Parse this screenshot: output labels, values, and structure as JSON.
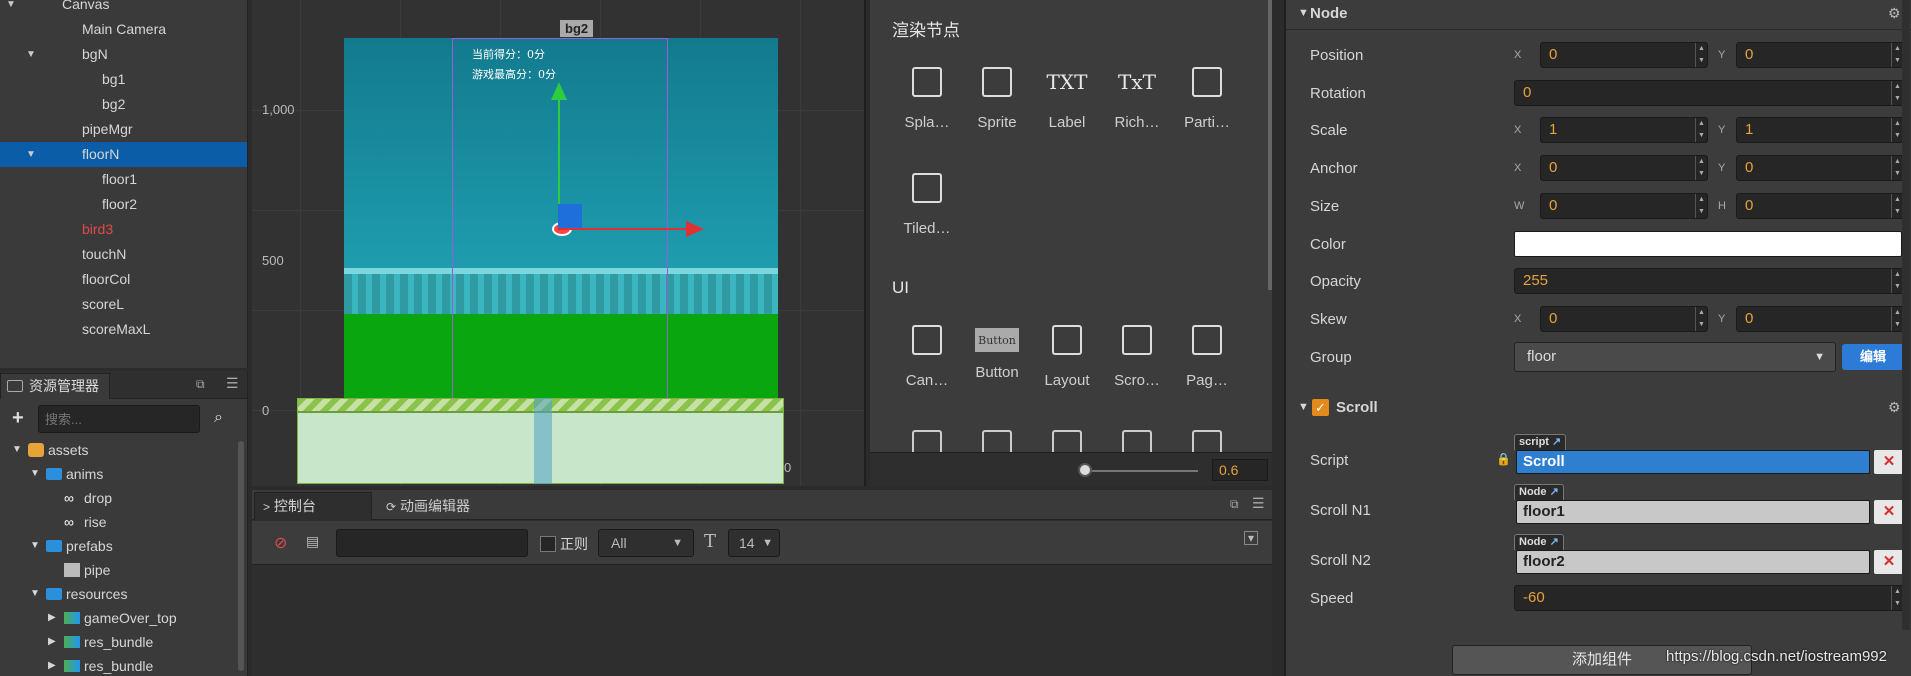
{
  "hierarchy": {
    "items": [
      {
        "label": "Canvas",
        "depth": 0,
        "arrow": "open"
      },
      {
        "label": "Main Camera",
        "depth": 1,
        "arrow": ""
      },
      {
        "label": "bgN",
        "depth": 1,
        "arrow": "open"
      },
      {
        "label": "bg1",
        "depth": 2,
        "arrow": ""
      },
      {
        "label": "bg2",
        "depth": 2,
        "arrow": ""
      },
      {
        "label": "pipeMgr",
        "depth": 1,
        "arrow": ""
      },
      {
        "label": "floorN",
        "depth": 1,
        "arrow": "open",
        "selected": true
      },
      {
        "label": "floor1",
        "depth": 2,
        "arrow": ""
      },
      {
        "label": "floor2",
        "depth": 2,
        "arrow": ""
      },
      {
        "label": "bird3",
        "depth": 1,
        "arrow": "",
        "color": "#e04a4a"
      },
      {
        "label": "touchN",
        "depth": 1,
        "arrow": ""
      },
      {
        "label": "floorCol",
        "depth": 1,
        "arrow": ""
      },
      {
        "label": "scoreL",
        "depth": 1,
        "arrow": ""
      },
      {
        "label": "scoreMaxL",
        "depth": 1,
        "arrow": ""
      }
    ]
  },
  "assets": {
    "tab_label": "资源管理器",
    "search_placeholder": "搜索...",
    "tree": [
      {
        "label": "assets",
        "depth": 0,
        "arrow": "▼",
        "icon": "db-icon"
      },
      {
        "label": "anims",
        "depth": 1,
        "arrow": "▼",
        "icon": "folder-icon"
      },
      {
        "label": "drop",
        "depth": 2,
        "arrow": "",
        "icon": "anim-icon"
      },
      {
        "label": "rise",
        "depth": 2,
        "arrow": "",
        "icon": "anim-icon"
      },
      {
        "label": "prefabs",
        "depth": 1,
        "arrow": "▼",
        "icon": "folder-icon"
      },
      {
        "label": "pipe",
        "depth": 2,
        "arrow": "",
        "icon": "prefab-icon"
      },
      {
        "label": "resources",
        "depth": 1,
        "arrow": "▼",
        "icon": "folder-icon"
      },
      {
        "label": "gameOver_top",
        "depth": 2,
        "arrow": "▶",
        "icon": "image-icon"
      },
      {
        "label": "res_bundle",
        "depth": 2,
        "arrow": "▶",
        "icon": "image-icon"
      },
      {
        "label": "res_bundle",
        "depth": 2,
        "arrow": "▶",
        "icon": "image-icon"
      }
    ]
  },
  "scene": {
    "node_tag": "bg2",
    "y_labels": [
      "1,000",
      "500",
      "0"
    ],
    "x_label_right": "0",
    "score_line1": "当前得分：0分",
    "score_line2": "游戏最高分：0分",
    "zoom": "0.6"
  },
  "palette": {
    "render_header": "渲染节点",
    "render_items": [
      {
        "label": "Spla…",
        "icon": "splash-icon"
      },
      {
        "label": "Sprite",
        "icon": "sprite-icon"
      },
      {
        "label": "Label",
        "icon": "label-icon",
        "glyph": "TXT"
      },
      {
        "label": "Rich…",
        "icon": "richtext-icon",
        "glyph": "TxT"
      },
      {
        "label": "Parti…",
        "icon": "particle-icon"
      },
      {
        "label": "Tiled…",
        "icon": "tiled-icon"
      }
    ],
    "ui_header": "UI",
    "ui_items": [
      {
        "label": "Can…",
        "icon": "canvas-icon"
      },
      {
        "label": "Button",
        "icon": "button-icon",
        "glyph": "Button"
      },
      {
        "label": "Layout",
        "icon": "layout-icon"
      },
      {
        "label": "Scro…",
        "icon": "scrollview-icon"
      },
      {
        "label": "Pag…",
        "icon": "pageview-icon"
      }
    ]
  },
  "console": {
    "tab_console": "控制台",
    "tab_anim": "动画编辑器",
    "regex_label": "正则",
    "level_value": "All",
    "font_size": "14"
  },
  "inspector": {
    "node_title": "Node",
    "props": {
      "position_label": "Position",
      "position_x": "0",
      "position_y": "0",
      "rotation_label": "Rotation",
      "rotation": "0",
      "scale_label": "Scale",
      "scale_x": "1",
      "scale_y": "1",
      "anchor_label": "Anchor",
      "anchor_x": "0",
      "anchor_y": "0",
      "size_label": "Size",
      "size_w": "0",
      "size_h": "0",
      "color_label": "Color",
      "color_value": "#ffffff",
      "opacity_label": "Opacity",
      "opacity": "255",
      "skew_label": "Skew",
      "skew_x": "0",
      "skew_y": "0",
      "group_label": "Group",
      "group_value": "floor",
      "edit_button": "编辑"
    },
    "scroll": {
      "title": "Scroll",
      "script_label": "Script",
      "script_tag": "script",
      "script_value": "Scroll",
      "n1_label": "Scroll N1",
      "n1_tag": "Node",
      "n1_value": "floor1",
      "n2_label": "Scroll N2",
      "n2_tag": "Node",
      "n2_value": "floor2",
      "speed_label": "Speed",
      "speed": "-60"
    },
    "add_component": "添加组件"
  },
  "watermark": "https://blog.csdn.net/iostream992"
}
